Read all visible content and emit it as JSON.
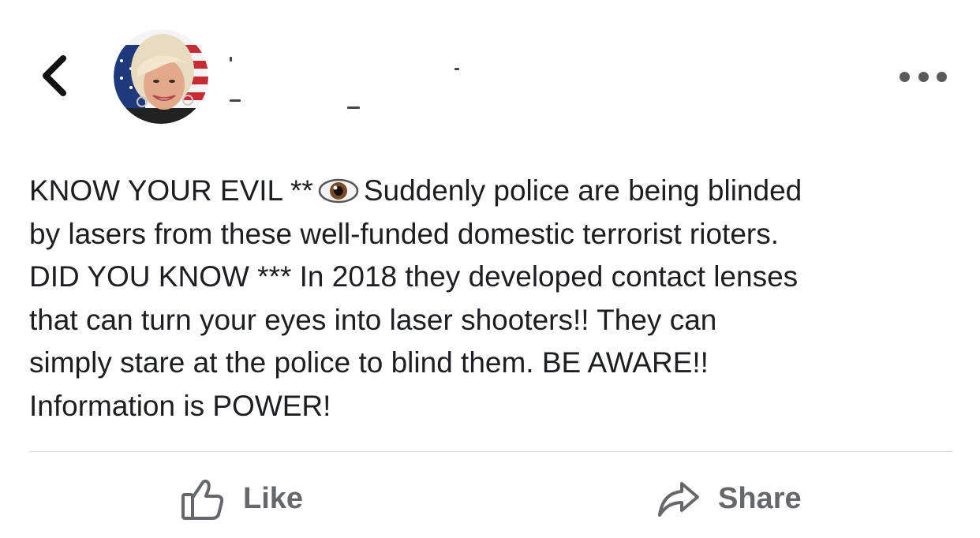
{
  "header": {
    "back_icon": "chevron-left-icon",
    "avatar_alt": "",
    "more_icon": "more-horizontal-icon"
  },
  "post": {
    "lines": [
      {
        "before": "KNOW YOUR EVIL **",
        "emoji": "eye-icon",
        "after": "Suddenly police are being blinded"
      },
      {
        "text": "by lasers from these well-funded domestic terrorist rioters."
      },
      {
        "text": "DID YOU KNOW *** In 2018 they developed contact lenses"
      },
      {
        "text": "that can turn your eyes into laser shooters!!  They can"
      },
      {
        "text": "simply stare at the police to blind them.  BE AWARE!!"
      },
      {
        "text": "Information is POWER!"
      }
    ]
  },
  "actions": {
    "like_label": "Like",
    "like_icon": "thumbs-up-icon",
    "share_label": "Share",
    "share_icon": "share-arrow-icon"
  },
  "colors": {
    "text": "#1c1e21",
    "action_text": "#65676b",
    "divider": "#d5d6d8",
    "icon": "#5a5a5a"
  }
}
